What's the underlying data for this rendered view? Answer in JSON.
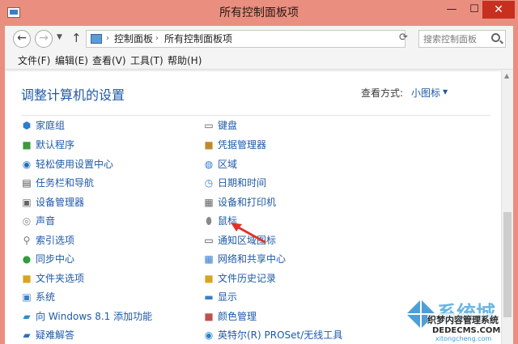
{
  "window": {
    "title": "所有控制面板项",
    "buttons": {
      "minimize": "—",
      "maximize": "☐",
      "close": "✕"
    }
  },
  "addressbar": {
    "back_icon": "←",
    "forward_icon": "→",
    "up_icon": "↑",
    "breadcrumb": [
      "控制面板",
      "所有控制面板项"
    ],
    "separator": "›",
    "search_placeholder": "搜索控制面板"
  },
  "menubar": {
    "items": [
      "文件(F)",
      "编辑(E)",
      "查看(V)",
      "工具(T)",
      "帮助(H)"
    ]
  },
  "content": {
    "title": "调整计算机的设置",
    "view_by_label": "查看方式:",
    "view_by_value": "小图标",
    "left_items": [
      {
        "label": "家庭组",
        "icon": "homegroup-icon"
      },
      {
        "label": "默认程序",
        "icon": "default-programs-icon"
      },
      {
        "label": "轻松使用设置中心",
        "icon": "ease-of-access-icon"
      },
      {
        "label": "任务栏和导航",
        "icon": "taskbar-icon"
      },
      {
        "label": "设备管理器",
        "icon": "device-manager-icon"
      },
      {
        "label": "声音",
        "icon": "sound-icon"
      },
      {
        "label": "索引选项",
        "icon": "indexing-icon"
      },
      {
        "label": "同步中心",
        "icon": "sync-icon"
      },
      {
        "label": "文件夹选项",
        "icon": "folder-options-icon"
      },
      {
        "label": "系统",
        "icon": "system-icon"
      },
      {
        "label": "向 Windows 8.1 添加功能",
        "icon": "add-features-icon"
      },
      {
        "label": "疑难解答",
        "icon": "troubleshooting-icon"
      }
    ],
    "right_items": [
      {
        "label": "键盘",
        "icon": "keyboard-icon"
      },
      {
        "label": "凭据管理器",
        "icon": "credential-manager-icon"
      },
      {
        "label": "区域",
        "icon": "region-icon"
      },
      {
        "label": "日期和时间",
        "icon": "date-time-icon"
      },
      {
        "label": "设备和打印机",
        "icon": "devices-printers-icon"
      },
      {
        "label": "鼠标",
        "icon": "mouse-icon"
      },
      {
        "label": "通知区域图标",
        "icon": "notification-icon"
      },
      {
        "label": "网络和共享中心",
        "icon": "network-icon"
      },
      {
        "label": "文件历史记录",
        "icon": "file-history-icon"
      },
      {
        "label": "显示",
        "icon": "display-icon"
      },
      {
        "label": "颜色管理",
        "icon": "color-management-icon"
      },
      {
        "label": "英特尔(R) PROSet/无线工具",
        "icon": "intel-wireless-icon"
      }
    ]
  },
  "watermark": {
    "text": "系统城",
    "site": "xitongcheng.com",
    "overlay": "织梦内容管理系统",
    "overlay_site": "DEDECMS.COM"
  },
  "colors": {
    "titlebar": "#ea8f7f",
    "link": "#1e5aa8",
    "close": "#c7301f",
    "arrow": "#e0322a"
  }
}
